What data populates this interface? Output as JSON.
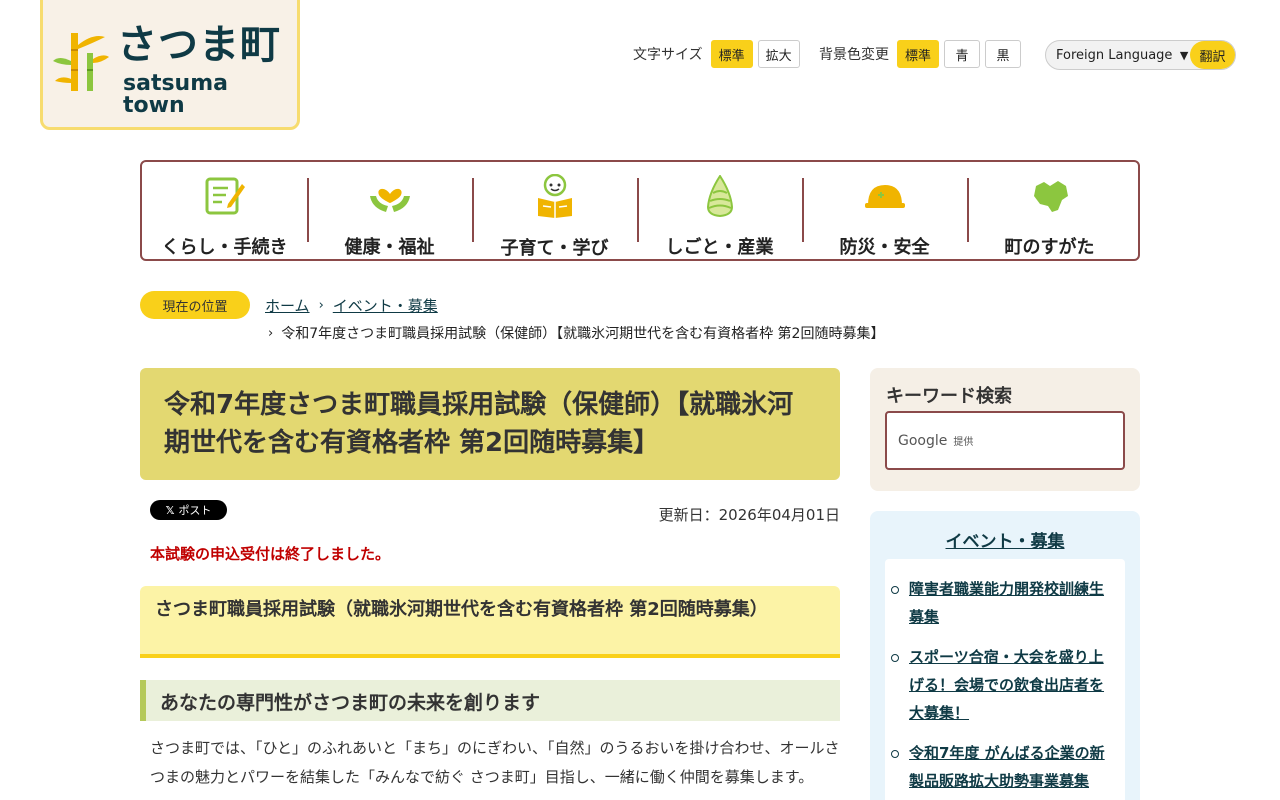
{
  "header": {
    "logo_jp": "さつま町",
    "logo_en": "satsuma town",
    "font_size_label": "文字サイズ",
    "font_size_standard": "標準",
    "font_size_large": "拡大",
    "bg_color_label": "背景色変更",
    "bg_standard": "標準",
    "bg_blue": "青",
    "bg_black": "黒",
    "language_select": "Foreign Language",
    "translate_button": "翻訳"
  },
  "global_nav": [
    {
      "label": "くらし・手続き",
      "icon": "document-pen-icon"
    },
    {
      "label": "健康・福祉",
      "icon": "heart-hands-icon"
    },
    {
      "label": "子育て・学び",
      "icon": "child-book-icon"
    },
    {
      "label": "しごと・産業",
      "icon": "bamboo-shoot-icon"
    },
    {
      "label": "防災・安全",
      "icon": "helmet-icon"
    },
    {
      "label": "町のすがた",
      "icon": "town-map-icon"
    }
  ],
  "breadcrumb": {
    "badge": "現在の位置",
    "home": "ホーム",
    "parent": "イベント・募集",
    "current": "令和7年度さつま町職員採用試験（保健師）【就職氷河期世代を含む有資格者枠 第2回随時募集】"
  },
  "main": {
    "title": "令和7年度さつま町職員採用試験（保健師）【就職氷河期世代を含む有資格者枠 第2回随時募集】",
    "x_post": "ポスト",
    "updated": "更新日：2026年04月01日",
    "closed_notice": "本試験の申込受付は終了しました。",
    "h2": "さつま町職員採用試験（就職氷河期世代を含む有資格者枠 第2回随時募集）",
    "h3": "あなたの専門性がさつま町の未来を創ります",
    "body": "さつま町では、「ひと」のふれあいと「まち」のにぎわい、「自然」のうるおいを掛け合わせ、オールさつまの魅力とパワーを結集した「みんなで紡ぐ さつま町」目指し、一緒に働く仲間を募集します。"
  },
  "sidebar": {
    "search_title": "キーワード検索",
    "search_google": "Google",
    "search_provided": "提供",
    "category_heading": "イベント・募集",
    "items": [
      "障害者職業能力開発校訓練生募集",
      "スポーツ合宿・大会を盛り上げる！会場での飲食出店者を大募集！",
      "令和7年度 がんばる企業の新製品販路拡大助勢事業募集"
    ]
  },
  "colors": {
    "accent_yellow": "#f9d01a",
    "brand_dark": "#0f3a45",
    "nav_border": "#8b4a4a",
    "title_bg": "#e3d871",
    "notice_red": "#c00000"
  }
}
